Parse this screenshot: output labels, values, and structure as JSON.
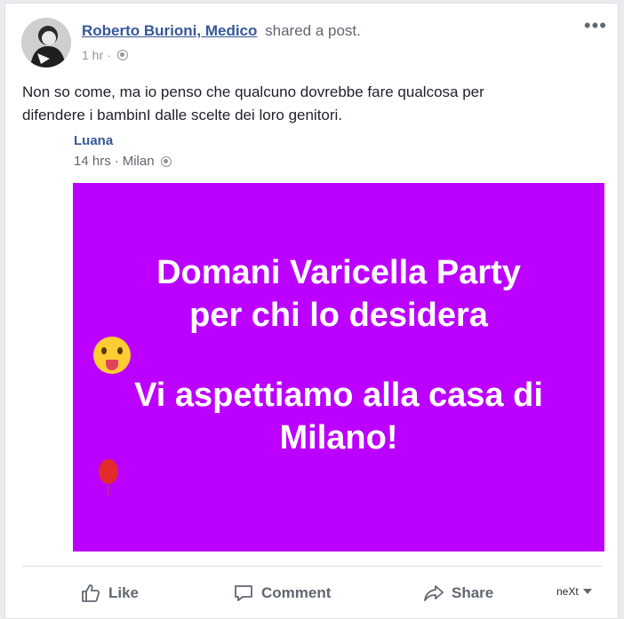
{
  "post": {
    "author": "Roberto Burioni, Medico",
    "action": "shared a post.",
    "time": "1 hr",
    "separator": "·",
    "text_line1": "Non so come, ma io penso che qualcuno dovrebbe fare qualcosa per",
    "text_line2": "difendere i bambinI dalle scelte dei loro genitori.",
    "more_label": "•••"
  },
  "shared_post": {
    "author": "Luana",
    "time": "14 hrs",
    "separator": "·",
    "location": "Milan",
    "background_color": "#bb00ff",
    "message": {
      "line1": "Domani Varicella Party",
      "line2": "per chi lo desidera",
      "line3": "Vi aspettiamo alla casa di",
      "line4": "Milano!"
    }
  },
  "actions": {
    "like": "Like",
    "comment": "Comment",
    "share": "Share",
    "next": "neXt"
  },
  "colors": {
    "link": "#365899",
    "muted": "#90949c",
    "text": "#1d2129"
  }
}
